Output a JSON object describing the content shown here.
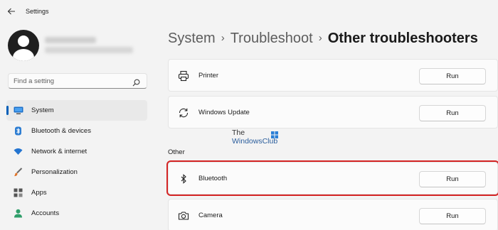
{
  "window": {
    "title": "Settings"
  },
  "profile": {
    "name": "",
    "email": ""
  },
  "search": {
    "placeholder": "Find a setting"
  },
  "sidebar": {
    "items": [
      {
        "label": "System",
        "icon": "monitor-icon",
        "active": true
      },
      {
        "label": "Bluetooth & devices",
        "icon": "bluetooth-devices-icon"
      },
      {
        "label": "Network & internet",
        "icon": "wifi-icon"
      },
      {
        "label": "Personalization",
        "icon": "brush-icon"
      },
      {
        "label": "Apps",
        "icon": "apps-icon"
      },
      {
        "label": "Accounts",
        "icon": "person-icon"
      }
    ]
  },
  "breadcrumb": {
    "items": [
      "System",
      "Troubleshoot"
    ],
    "current": "Other troubleshooters"
  },
  "troubleshooters": [
    {
      "label": "Printer",
      "icon": "printer-icon",
      "button": "Run"
    },
    {
      "label": "Windows Update",
      "icon": "refresh-icon",
      "button": "Run"
    }
  ],
  "other_section": {
    "heading": "Other",
    "items": [
      {
        "label": "Bluetooth",
        "icon": "bluetooth-icon",
        "button": "Run",
        "highlighted": true
      },
      {
        "label": "Camera",
        "icon": "camera-icon",
        "button": "Run"
      }
    ]
  },
  "watermark": {
    "line1": "The",
    "line2": "WindowsClub"
  },
  "colors": {
    "accent": "#005fb8",
    "highlight_border": "#d42424",
    "background": "#f3f3f3",
    "card": "#fbfbfb"
  }
}
